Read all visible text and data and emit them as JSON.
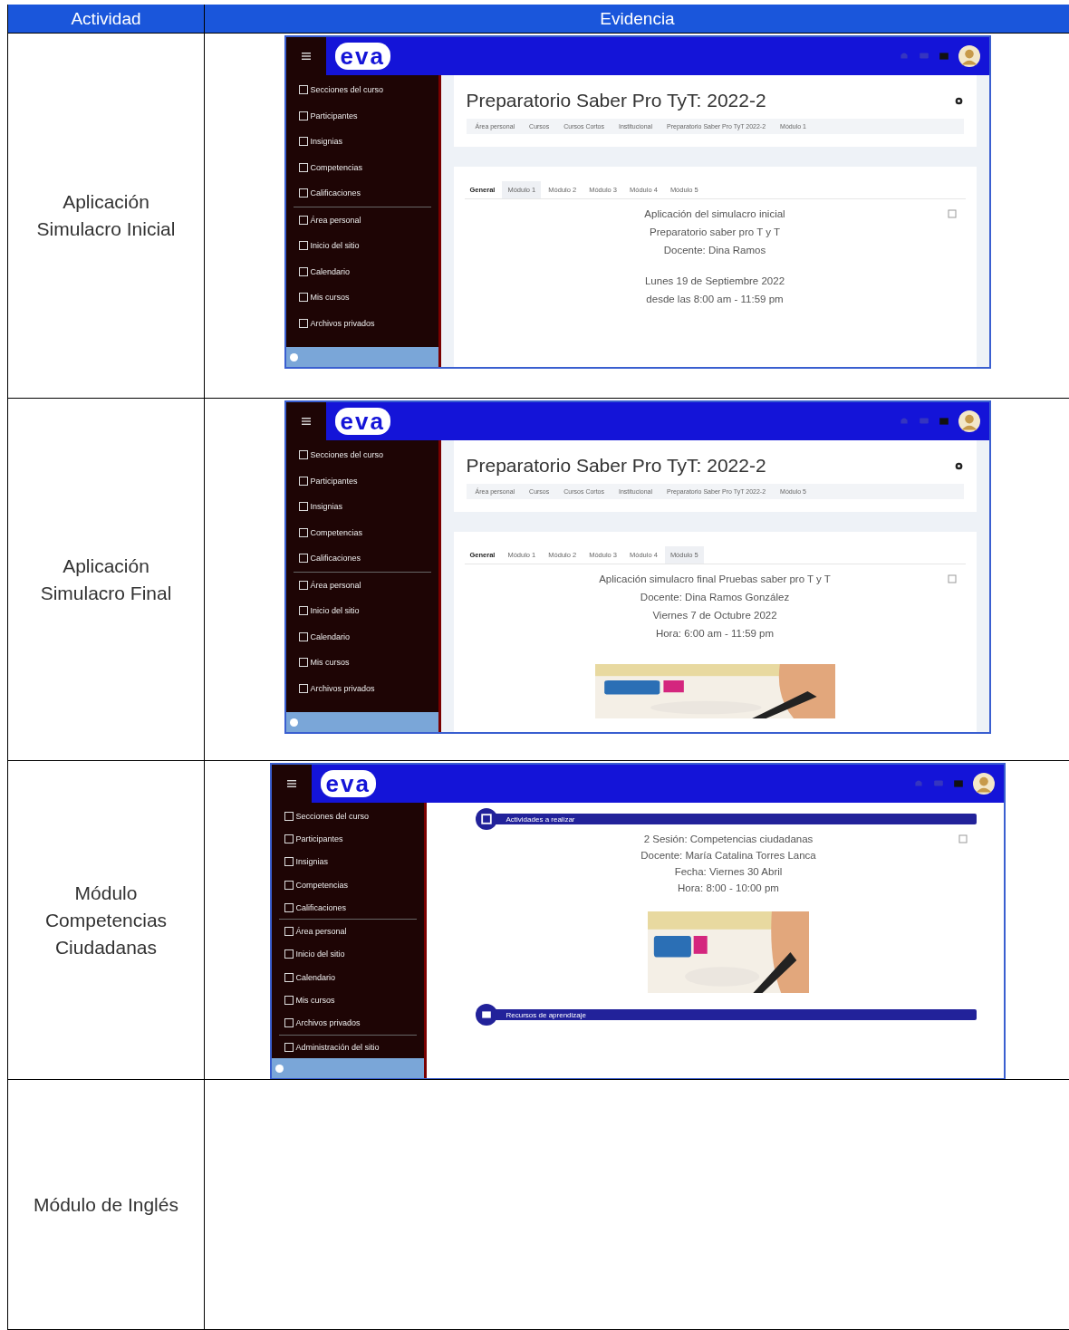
{
  "table": {
    "columns": [
      "Actividad",
      "Evidencia"
    ],
    "rows": [
      {
        "activity": "Aplicación Simulacro Inicial",
        "evidence": {
          "kind": "course_page",
          "logo": "eva",
          "sidebar": [
            "Secciones del curso",
            "Participantes",
            "Insignias",
            "Competencias",
            "Calificaciones",
            "Área personal",
            "Inicio del sitio",
            "Calendario",
            "Mis cursos",
            "Archivos privados"
          ],
          "title": "Preparatorio Saber Pro TyT: 2022-2",
          "breadcrumbs": [
            "Área personal",
            "Cursos",
            "Cursos Cortos",
            "Institucional",
            "Preparatorio Saber Pro TyT 2022-2",
            "Módulo 1"
          ],
          "tabs": [
            {
              "label": "General",
              "selected": false
            },
            {
              "label": "Módulo 1",
              "selected": true
            },
            {
              "label": "Módulo 2",
              "selected": false
            },
            {
              "label": "Módulo 3",
              "selected": false
            },
            {
              "label": "Módulo 4",
              "selected": false
            },
            {
              "label": "Módulo 5",
              "selected": false
            }
          ],
          "lines": [
            "Aplicación  del simulacro inicial",
            "Preparatorio saber pro T y T",
            "Docente: Dina Ramos"
          ],
          "schedule": [
            "Lunes 19 de Septiembre 2022",
            "desde las 8:00 am - 11:59 pm"
          ]
        }
      },
      {
        "activity": "Aplicación Simulacro Final",
        "evidence": {
          "kind": "course_page",
          "logo": "eva",
          "sidebar": [
            "Secciones del curso",
            "Participantes",
            "Insignias",
            "Competencias",
            "Calificaciones",
            "Área personal",
            "Inicio del sitio",
            "Calendario",
            "Mis cursos",
            "Archivos privados"
          ],
          "title": "Preparatorio Saber Pro TyT: 2022-2",
          "breadcrumbs": [
            "Área personal",
            "Cursos",
            "Cursos Cortos",
            "Institucional",
            "Preparatorio Saber Pro TyT 2022-2",
            "Módulo 5"
          ],
          "tabs": [
            {
              "label": "General",
              "selected": false
            },
            {
              "label": "Módulo 1",
              "selected": false
            },
            {
              "label": "Módulo 2",
              "selected": false
            },
            {
              "label": "Módulo 3",
              "selected": false
            },
            {
              "label": "Módulo 4",
              "selected": false
            },
            {
              "label": "Módulo 5",
              "selected": true
            }
          ],
          "lines": [
            "Aplicación simulacro final Pruebas saber pro T y T",
            "Docente: Dina Ramos González",
            "Viernes 7 de Octubre 2022",
            "Hora: 6:00 am - 11:59 pm"
          ],
          "picture": {
            "kind": "picture"
          }
        }
      },
      {
        "activity": "Módulo Competencias Ciudadanas",
        "evidence": {
          "kind": "activity_page",
          "logo": "eva",
          "sidebar": [
            "Secciones del curso",
            "Participantes",
            "Insignias",
            "Competencias",
            "Calificaciones",
            "Área personal",
            "Inicio del sitio",
            "Calendario",
            "Mis cursos",
            "Archivos privados",
            "Administración del sitio"
          ],
          "section_header": "Actividades a realizar",
          "lines": [
            "2 Sesión: Competencias ciudadanas",
            "Docente: María Catalina Torres Lanca",
            "Fecha: Viernes 30 Abril",
            "Hora: 8:00 - 10:00 pm"
          ],
          "picture": {
            "kind": "picture"
          },
          "section_footer": "Recursos de aprendizaje"
        }
      },
      {
        "activity": "Módulo de Inglés"
      }
    ]
  }
}
